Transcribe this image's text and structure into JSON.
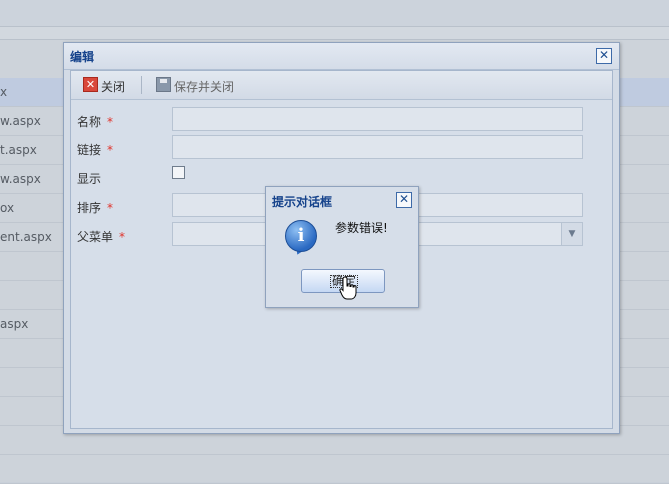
{
  "background": {
    "rows": [
      {
        "text": "x",
        "selected": true
      },
      {
        "text": "w.aspx"
      },
      {
        "text": "t.aspx"
      },
      {
        "text": "w.aspx"
      },
      {
        "text": "ox"
      },
      {
        "text": "ent.aspx"
      },
      {
        "text": ""
      },
      {
        "text": ""
      },
      {
        "text": "aspx"
      },
      {
        "text": ""
      },
      {
        "text": ""
      },
      {
        "text": ""
      },
      {
        "text": ""
      },
      {
        "text": ""
      },
      {
        "text": ""
      }
    ]
  },
  "window": {
    "title": "编辑",
    "close_glyph": "✕",
    "toolbar": {
      "close_label": "关闭",
      "close_icon": "close-icon",
      "save_close_label": "保存并关闭",
      "save_icon": "save-icon"
    },
    "form": {
      "name_label": "名称",
      "link_label": "链接",
      "show_label": "显示",
      "order_label": "排序",
      "parent_menu_label": "父菜单",
      "required_mark": "*",
      "name_value": "",
      "link_value": "",
      "order_value": "",
      "parent_menu_value": "",
      "dropdown_glyph": "▼"
    }
  },
  "message_box": {
    "title": "提示对话框",
    "close_glyph": "✕",
    "icon": "info-icon",
    "icon_glyph": "i",
    "message": "参数错误!",
    "ok_label": "确定"
  },
  "colors": {
    "title_text": "#15428b",
    "required": "#e0322a",
    "accent_border": "#8fa2bd"
  }
}
